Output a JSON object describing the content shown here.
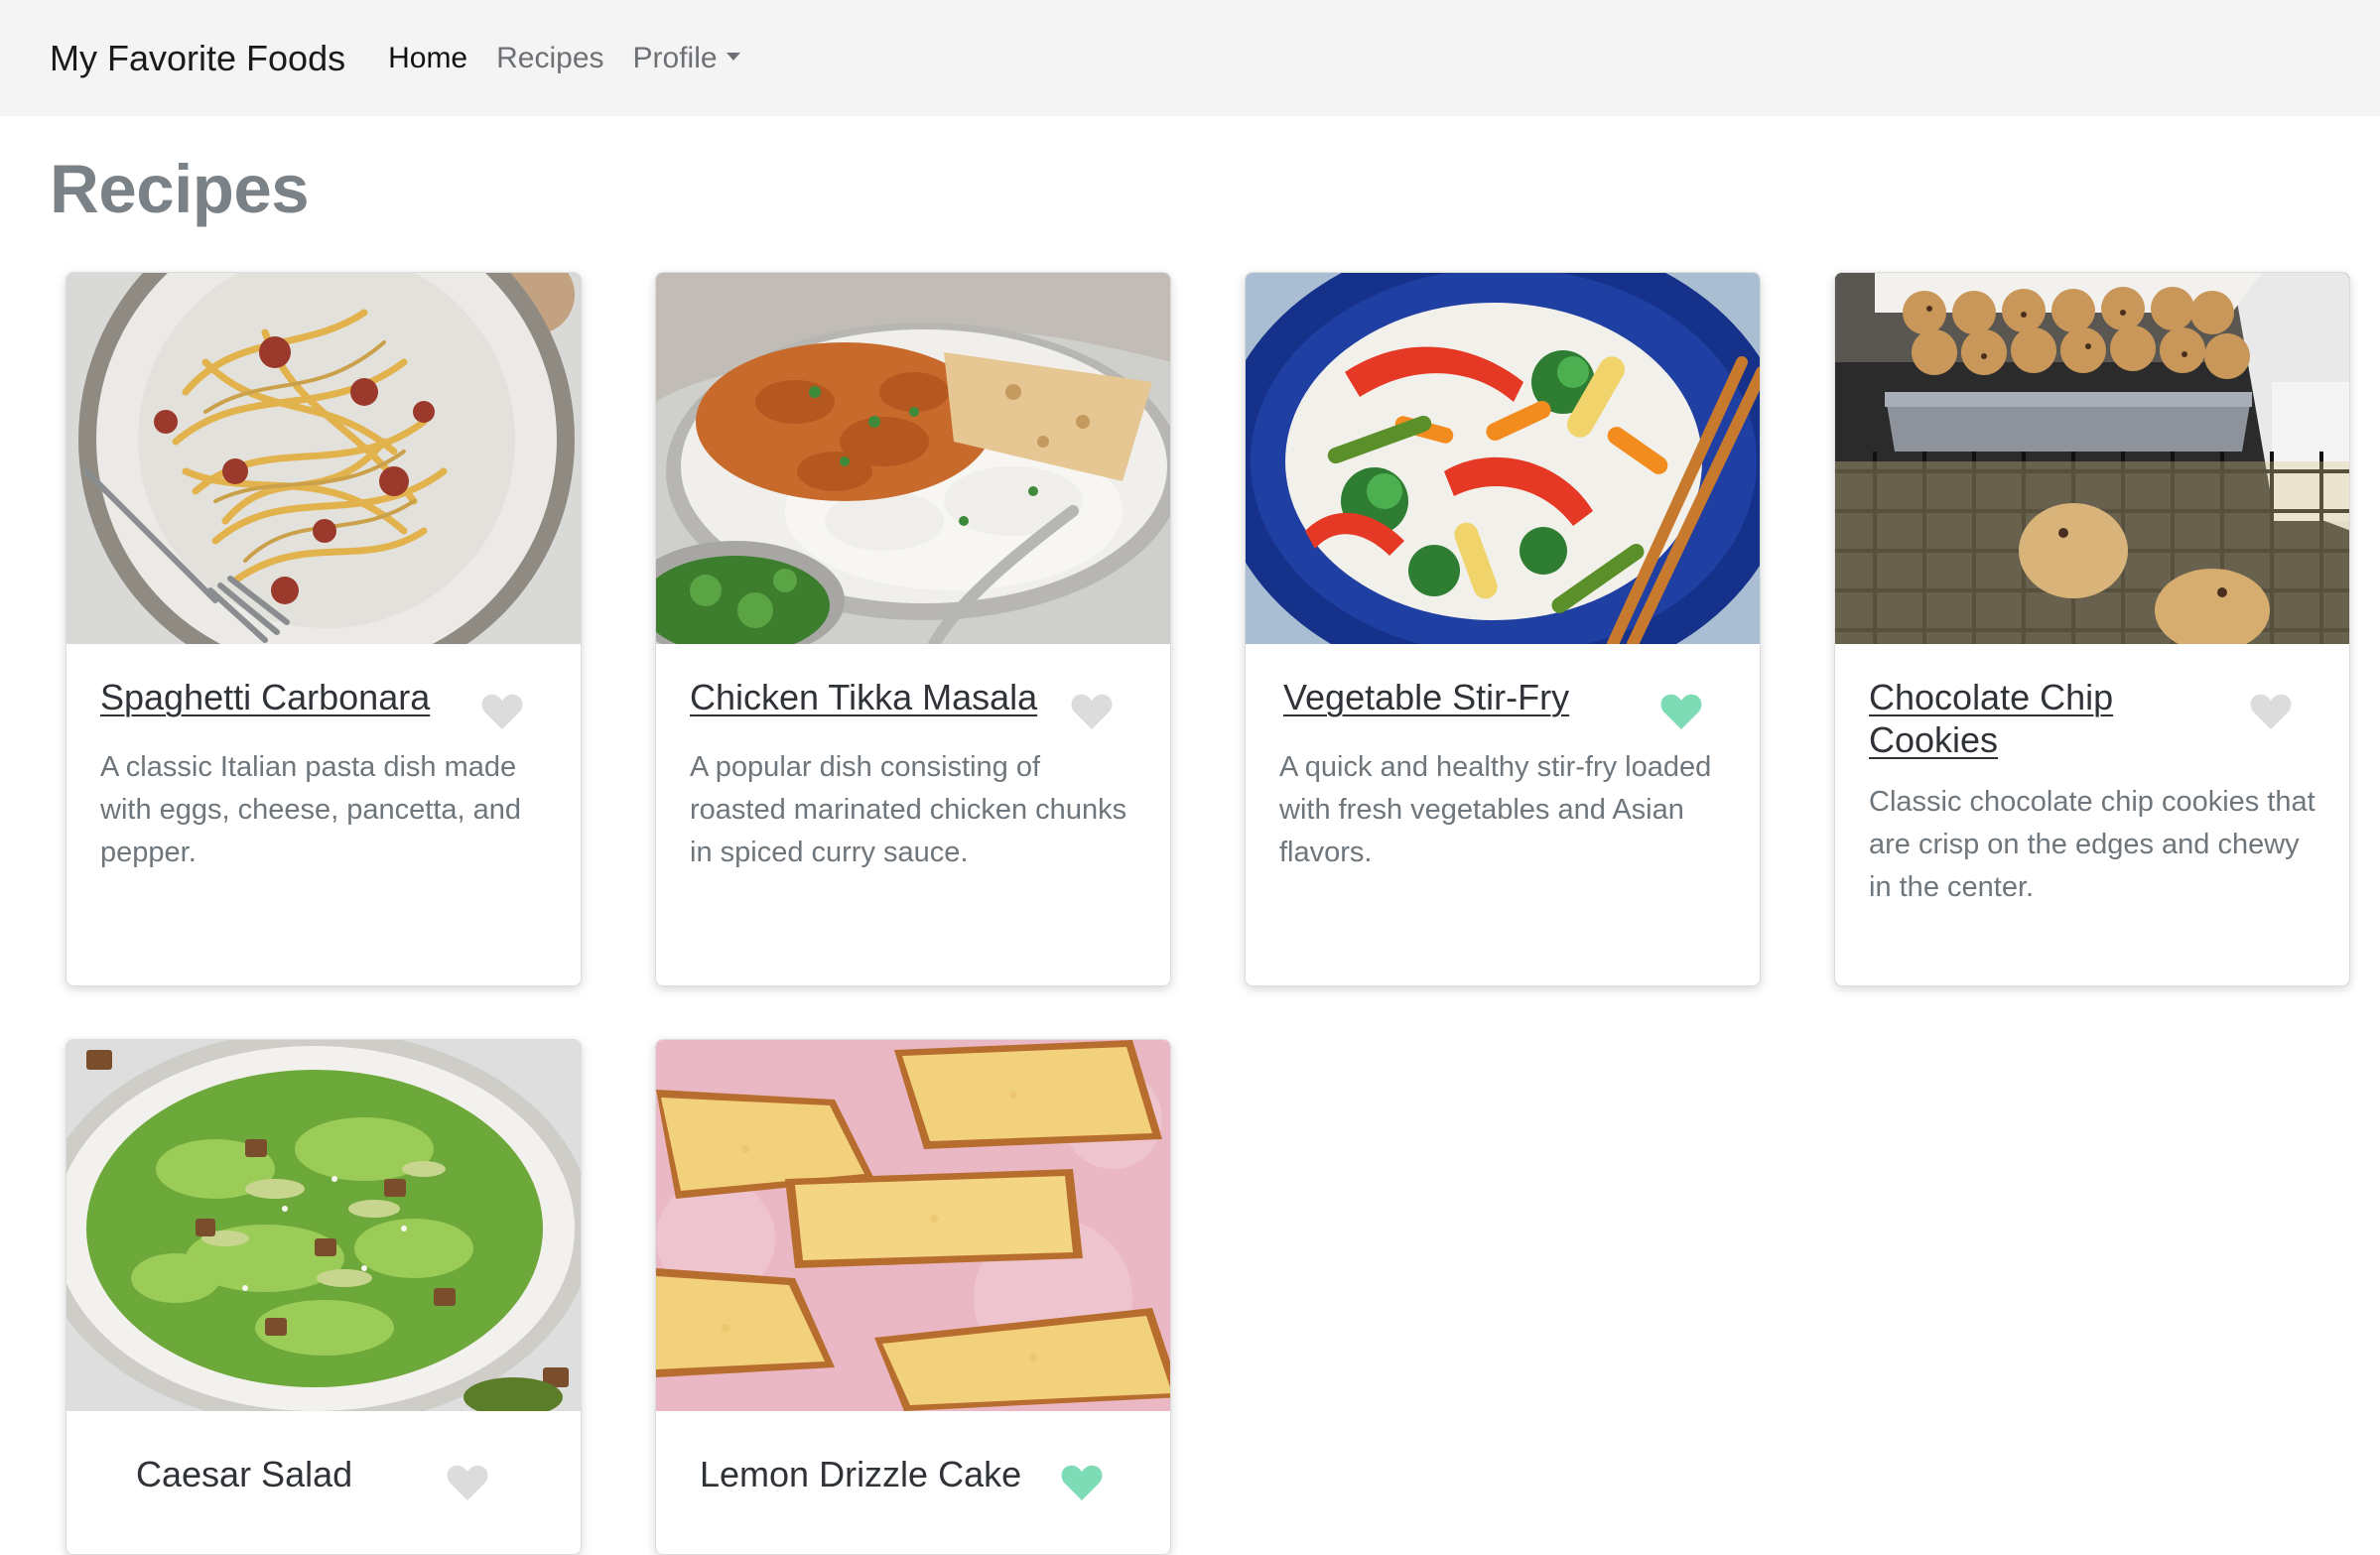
{
  "navbar": {
    "brand": "My Favorite Foods",
    "links": [
      {
        "label": "Home"
      },
      {
        "label": "Recipes"
      },
      {
        "label": "Profile"
      }
    ]
  },
  "page": {
    "title": "Recipes"
  },
  "colors": {
    "heart_favorited": "#7ddcb6",
    "heart_default": "#dcdcdc",
    "navbar_bg": "#f4f4f4"
  },
  "recipes": [
    {
      "title": "Spaghetti Carbonara",
      "description": "A classic Italian pasta dish made with eggs, cheese, pancetta, and pepper.",
      "favorited": false,
      "image": "spaghetti-carbonara-photo"
    },
    {
      "title": "Chicken Tikka Masala",
      "description": "A popular dish consisting of roasted marinated chicken chunks in spiced curry sauce.",
      "favorited": false,
      "image": "chicken-tikka-masala-photo"
    },
    {
      "title": "Vegetable Stir-Fry",
      "description": "A quick and healthy stir-fry loaded with fresh vegetables and Asian flavors.",
      "favorited": true,
      "image": "vegetable-stir-fry-photo"
    },
    {
      "title": "Chocolate Chip Cookies",
      "description": "Classic chocolate chip cookies that are crisp on the edges and chewy in the center.",
      "favorited": false,
      "image": "chocolate-chip-cookies-photo"
    },
    {
      "title": "Caesar Salad",
      "description": "",
      "favorited": false,
      "image": "caesar-salad-photo"
    },
    {
      "title": "Lemon Drizzle Cake",
      "description": "",
      "favorited": true,
      "image": "lemon-drizzle-cake-photo"
    }
  ]
}
